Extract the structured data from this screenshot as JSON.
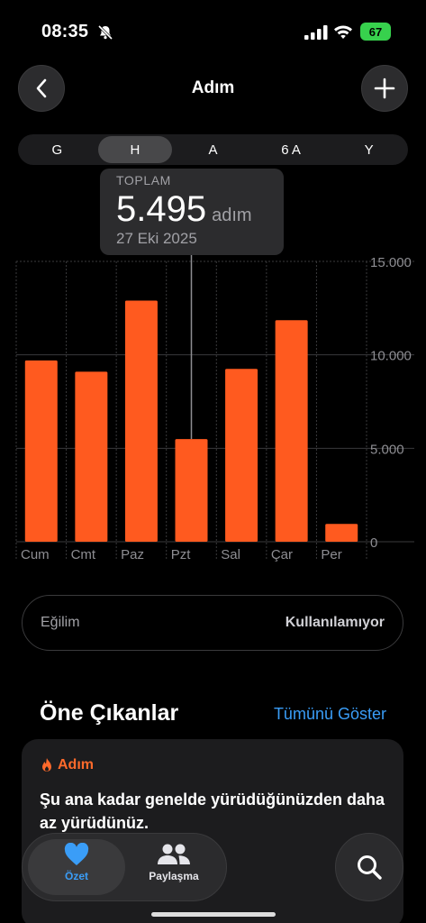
{
  "status": {
    "time": "08:35",
    "battery": "67"
  },
  "nav": {
    "title": "Adım"
  },
  "segments": [
    {
      "label": "G",
      "active": false
    },
    {
      "label": "H",
      "active": true
    },
    {
      "label": "A",
      "active": false
    },
    {
      "label": "6 A",
      "active": false
    },
    {
      "label": "Y",
      "active": false
    }
  ],
  "tooltip": {
    "label": "TOPLAM",
    "value": "5.495",
    "unit": "adım",
    "date": "27 Eki 2025"
  },
  "chart_data": {
    "type": "bar",
    "categories": [
      "Cum",
      "Cmt",
      "Paz",
      "Pzt",
      "Sal",
      "Çar",
      "Per"
    ],
    "values": [
      9700,
      9100,
      12900,
      5495,
      9250,
      11850,
      950
    ],
    "y_ticks": [
      "15.000",
      "10.000",
      "5.000",
      "0"
    ],
    "ylim": [
      0,
      15000
    ],
    "selected_index": 3,
    "bar_color": "#ff5a1f",
    "grid": true
  },
  "trend": {
    "label": "Eğilim",
    "value": "Kullanılamıyor"
  },
  "highlights": {
    "title": "Öne Çıkanlar",
    "show_all": "Tümünü Göster",
    "card": {
      "category": "Adım",
      "text": "Şu ana kadar genelde yürüdüğünüzden daha az yürüdünüz."
    }
  },
  "tabbar": {
    "tabs": [
      {
        "label": "Özet",
        "icon": "heart-icon",
        "active": true
      },
      {
        "label": "Paylaşma",
        "icon": "people-icon",
        "active": false
      }
    ]
  },
  "colors": {
    "accent": "#3a9df7",
    "steps": "#ff5a1f",
    "battery": "#37d14d"
  }
}
